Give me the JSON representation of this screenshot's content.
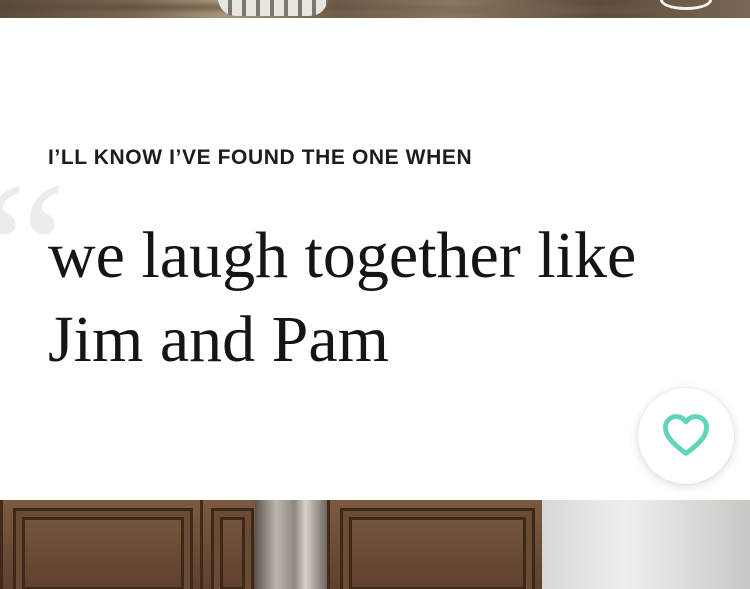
{
  "prompt": {
    "label": "I’LL KNOW I’VE FOUND THE ONE WHEN",
    "answer": "we laugh together like Jim and Pam",
    "quote_glyph": "“"
  },
  "like_button": {
    "icon": "heart-outline-icon",
    "color": "#5fd6ba"
  },
  "photos": {
    "top": "photo-strip",
    "bottom": "photo-strip"
  }
}
